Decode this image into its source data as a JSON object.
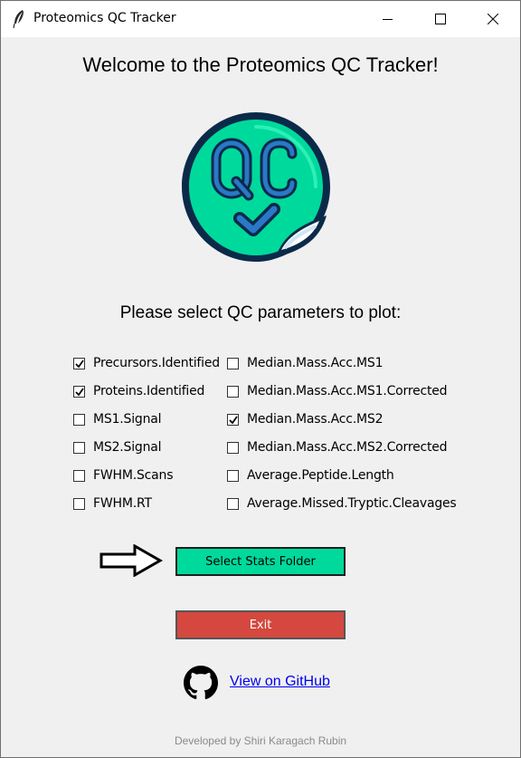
{
  "window": {
    "title": "Proteomics QC Tracker",
    "icon": "feather-icon",
    "controls": [
      "minimize-icon",
      "maximize-icon",
      "close-icon"
    ]
  },
  "heading": "Welcome to the Proteomics QC Tracker!",
  "logo": {
    "text": "QC",
    "icon": "qc-sticker-checkmark-icon",
    "accent": "#00d99c",
    "outline": "#0b2a49"
  },
  "subheading": "Please select QC parameters to plot:",
  "parameters": {
    "left": [
      {
        "label": "Precursors.Identified",
        "checked": true
      },
      {
        "label": "Proteins.Identified",
        "checked": true
      },
      {
        "label": "MS1.Signal",
        "checked": false
      },
      {
        "label": "MS2.Signal",
        "checked": false
      },
      {
        "label": "FWHM.Scans",
        "checked": false
      },
      {
        "label": "FWHM.RT",
        "checked": false
      }
    ],
    "right": [
      {
        "label": "Median.Mass.Acc.MS1",
        "checked": false
      },
      {
        "label": "Median.Mass.Acc.MS1.Corrected",
        "checked": false
      },
      {
        "label": "Median.Mass.Acc.MS2",
        "checked": true
      },
      {
        "label": "Median.Mass.Acc.MS2.Corrected",
        "checked": false
      },
      {
        "label": "Average.Peptide.Length",
        "checked": false
      },
      {
        "label": "Average.Missed.Tryptic.Cleavages",
        "checked": false
      }
    ]
  },
  "arrow_icon": "right-arrow-icon",
  "buttons": {
    "select_stats": {
      "label": "Select Stats Folder",
      "color": "#00d99c"
    },
    "exit": {
      "label": "Exit",
      "color": "#d4483f"
    }
  },
  "github": {
    "icon": "github-icon",
    "link_text": "View on GitHub"
  },
  "footer": "Developed by Shiri Karagach Rubin"
}
